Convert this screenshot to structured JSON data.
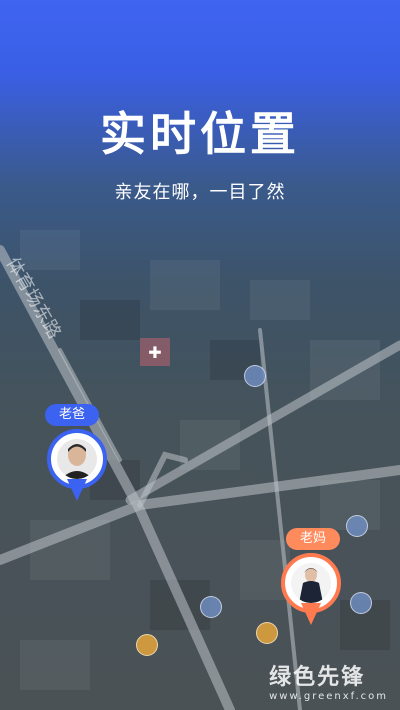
{
  "hero": {
    "title": "实时位置",
    "subtitle": "亲友在哪，一目了然"
  },
  "map": {
    "road_label": "体育场东路"
  },
  "pins": [
    {
      "label": "老爸",
      "label_color": "#3b62f0",
      "pin_color": "#3b62f0",
      "avatar": "man-portrait"
    },
    {
      "label": "老妈",
      "label_color": "#ff8a5c",
      "pin_color": "#ff7b4f",
      "avatar": "woman-portrait"
    }
  ],
  "watermark": {
    "name": "绿色先锋",
    "url": "www.greenxf.com"
  }
}
